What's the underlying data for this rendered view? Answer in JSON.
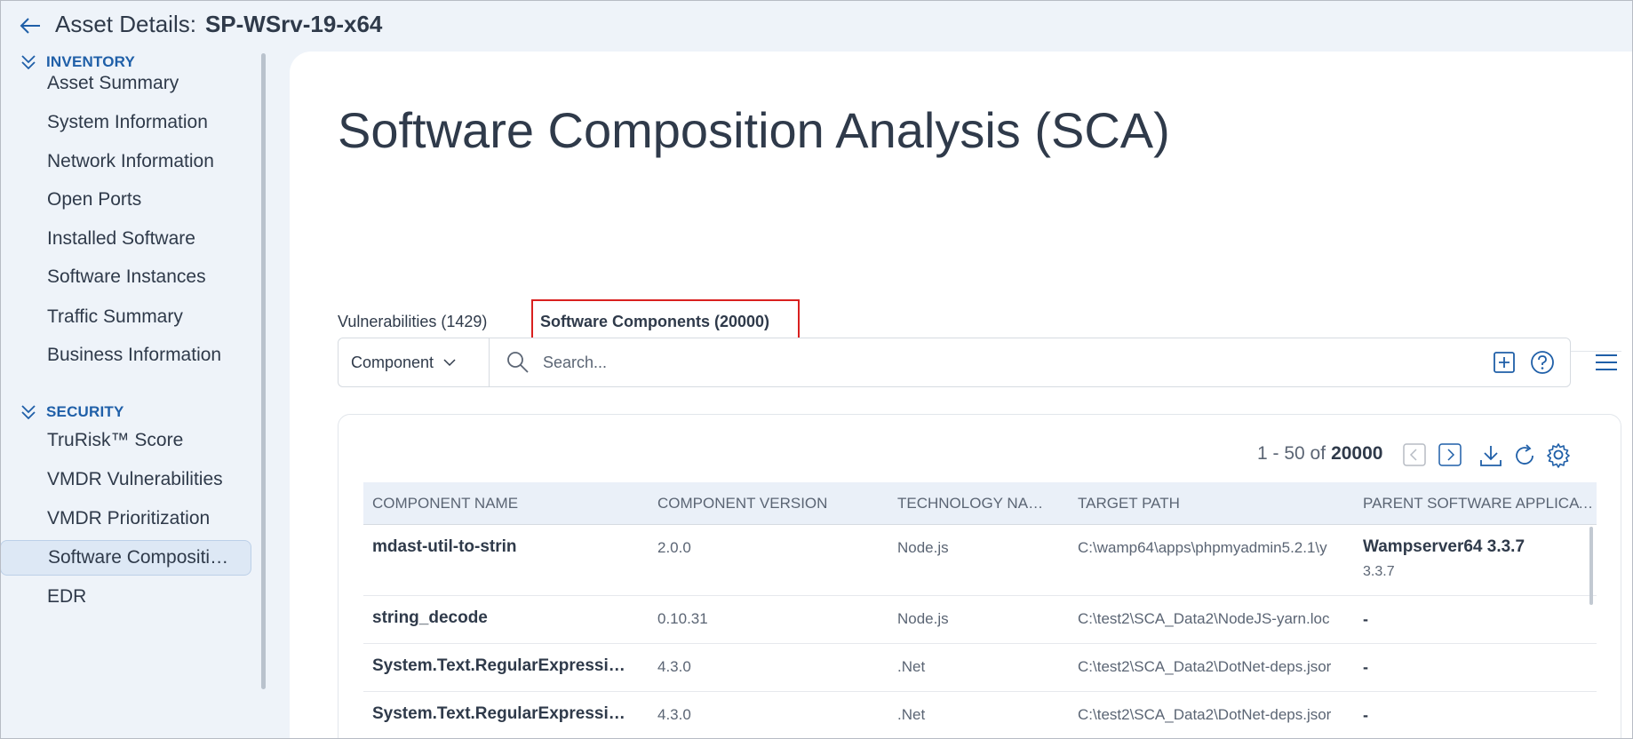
{
  "header": {
    "label": "Asset Details:",
    "asset_name": "SP-WSrv-19-x64"
  },
  "sidebar": {
    "sections": [
      {
        "title": "INVENTORY",
        "items": [
          {
            "label": "Asset Summary"
          },
          {
            "label": "System Information"
          },
          {
            "label": "Network Information"
          },
          {
            "label": "Open Ports"
          },
          {
            "label": "Installed Software"
          },
          {
            "label": "Software Instances"
          },
          {
            "label": "Traffic Summary"
          },
          {
            "label": "Business Information"
          }
        ]
      },
      {
        "title": "SECURITY",
        "items": [
          {
            "label": "TruRisk™ Score"
          },
          {
            "label": "VMDR Vulnerabilities"
          },
          {
            "label": "VMDR Prioritization"
          },
          {
            "label": "Software Compositi…",
            "active": true
          },
          {
            "label": "EDR"
          }
        ]
      }
    ]
  },
  "main": {
    "title": "Software Composition Analysis (SCA)",
    "tabs": [
      {
        "label": "Vulnerabilities (1429)"
      },
      {
        "label": "Software Components (20000)",
        "active": true
      }
    ],
    "search": {
      "field": "Component",
      "placeholder": "Search..."
    },
    "pager": {
      "range": "1 - 50 of",
      "total": "20000"
    },
    "table": {
      "columns": [
        "COMPONENT NAME",
        "COMPONENT VERSION",
        "TECHNOLOGY NAME",
        "TARGET PATH",
        "PARENT SOFTWARE APPLICATI…"
      ],
      "rows": [
        {
          "name": "mdast-util-to-strin",
          "version": "2.0.0",
          "tech": "Node.js",
          "path": "C:\\wamp64\\apps\\phpmyadmin5.2.1\\y",
          "parent": "Wampserver64 3.3.7",
          "parent_version": "3.3.7"
        },
        {
          "name": "string_decode",
          "version": "0.10.31",
          "tech": "Node.js",
          "path": "C:\\test2\\SCA_Data2\\NodeJS-yarn.loc",
          "parent": "-"
        },
        {
          "name": "System.Text.RegularExpressi…",
          "version": "4.3.0",
          "tech": ".Net",
          "path": "C:\\test2\\SCA_Data2\\DotNet-deps.jsor",
          "parent": "-"
        },
        {
          "name": "System.Text.RegularExpressi…",
          "version": "4.3.0",
          "tech": ".Net",
          "path": "C:\\test2\\SCA_Data2\\DotNet-deps.jsor",
          "parent": "-"
        }
      ]
    }
  },
  "colors": {
    "accent": "#1f5fa8",
    "highlight_box": "#d9201f",
    "background": "#eef3f9"
  }
}
